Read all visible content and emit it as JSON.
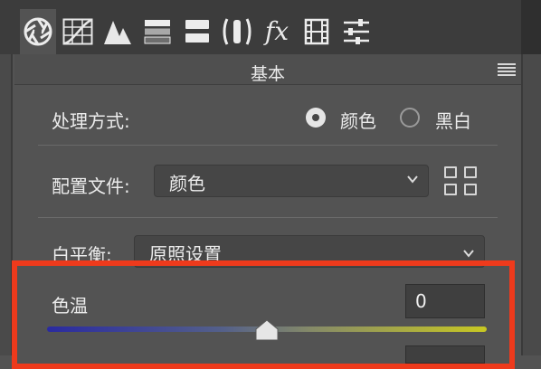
{
  "toolbar": {
    "tools": [
      {
        "icon": "aperture-icon",
        "active": true
      },
      {
        "icon": "tone-curve-grid-icon"
      },
      {
        "icon": "mountains-detail-icon"
      },
      {
        "icon": "hsl-bars-icon"
      },
      {
        "icon": "split-toning-icon"
      },
      {
        "icon": "lens-correction-icon"
      },
      {
        "icon": "fx-icon",
        "label": "fx"
      },
      {
        "icon": "film-strip-icon"
      },
      {
        "icon": "sliders-icon"
      }
    ]
  },
  "panel": {
    "title": "基本",
    "menu_icon": "panel-menu-icon"
  },
  "treatment": {
    "label": "处理方式:",
    "options": [
      "颜色",
      "黑白"
    ],
    "selected": "颜色"
  },
  "profile": {
    "label": "配置文件:",
    "value": "颜色",
    "browse_icon": "profile-grid-icon"
  },
  "white_balance": {
    "label": "白平衡:",
    "value": "原照设置"
  },
  "temperature": {
    "label": "色温",
    "value": "0",
    "slider_level": 0.5
  },
  "colors": {
    "highlight": "#ee3a1c",
    "panel_bg": "#535353"
  }
}
